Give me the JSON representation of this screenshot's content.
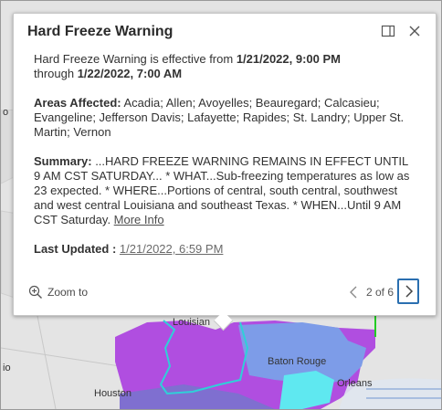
{
  "popup": {
    "title": "Hard Freeze Warning",
    "effective_prefix": "Hard Freeze Warning is effective from ",
    "effective_start": "1/21/2022, 9:00 PM",
    "effective_through": "through ",
    "effective_end": "1/22/2022, 7:00 AM",
    "areas_label": "Areas Affected:",
    "areas_text": " Acadia; Allen; Avoyelles; Beauregard; Calcasieu; Evangeline; Jefferson Davis; Lafayette; Rapides; St. Landry; Upper St. Martin; Vernon",
    "summary_label": "Summary:",
    "summary_text": " ...HARD FREEZE WARNING REMAINS IN EFFECT UNTIL 9 AM CST SATURDAY... * WHAT...Sub-freezing temperatures as low as 23 expected. * WHERE...Portions of central, south central, southwest and west central Louisiana and southeast Texas. * WHEN...Until 9 AM CST Saturday. ",
    "more_info": "More Info",
    "last_updated_label": "Last Updated :",
    "last_updated_value": "1/21/2022, 6:59 PM",
    "zoom_to": "Zoom to",
    "pager_text": "2 of 6",
    "icons": [
      "dock-icon",
      "close-icon",
      "zoom-in-icon",
      "chevron-left-icon",
      "chevron-right-icon"
    ]
  },
  "map": {
    "labels": {
      "louisiana": "Louisian",
      "baton_rouge": "Baton Rouge",
      "orleans": "Orleans",
      "houston": "Houston",
      "left_a": "o",
      "left_b": "io"
    },
    "colors": {
      "hard_freeze": "#b04ee0",
      "freeze": "#7f6fd0",
      "frost": "#6fa0e6",
      "cyan": "#5fe8f0",
      "outline": "#2fd0d8",
      "green": "#22cc22"
    }
  }
}
